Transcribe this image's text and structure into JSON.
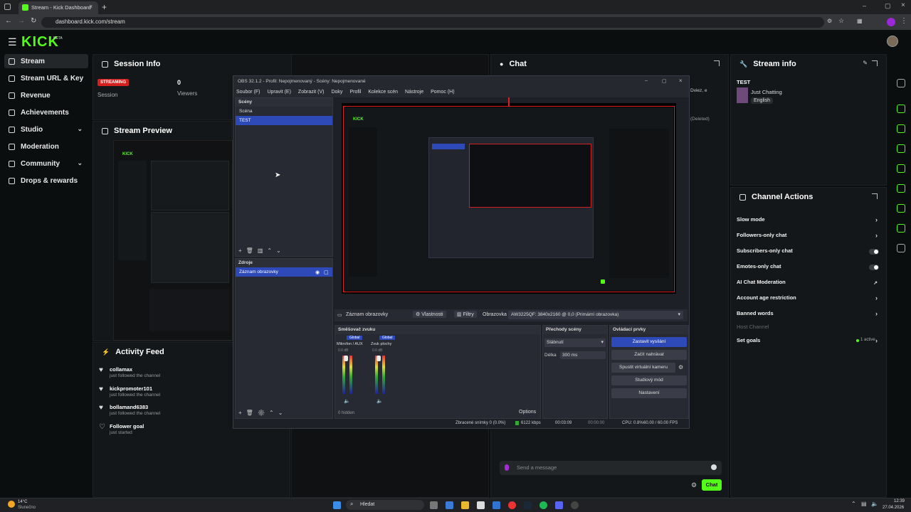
{
  "browser": {
    "tab_title": "Stream - Kick Dashboard",
    "url": "dashboard.kick.com/stream"
  },
  "header": {
    "logo": "KICK",
    "logo_badge": "BETA"
  },
  "sidenav": {
    "items": [
      {
        "label": "Stream",
        "icon": "stream-icon",
        "active": true
      },
      {
        "label": "Stream URL & Key",
        "icon": "key-icon"
      },
      {
        "label": "Revenue",
        "icon": "revenue-icon"
      },
      {
        "label": "Achievements",
        "icon": "trophy-icon"
      },
      {
        "label": "Studio",
        "icon": "studio-icon",
        "expandable": true
      },
      {
        "label": "Moderation",
        "icon": "sword-icon"
      },
      {
        "label": "Community",
        "icon": "community-icon",
        "expandable": true
      },
      {
        "label": "Drops & rewards",
        "icon": "gift-icon"
      }
    ]
  },
  "session": {
    "title": "Session Info",
    "badge": "STREAMING",
    "badge_color": "#d62020",
    "session_label": "Session",
    "viewers_value": "0",
    "viewers_label": "Viewers"
  },
  "stream_preview": {
    "title": "Stream Preview"
  },
  "activity": {
    "title": "Activity Feed",
    "items": [
      {
        "name": "collamax",
        "desc": "just followed the channel"
      },
      {
        "name": "kickpromoter101",
        "desc": "just followed the channel"
      },
      {
        "name": "bollamand6383",
        "desc": "just followed the channel"
      },
      {
        "name": "Follower goal",
        "desc": "just started"
      }
    ]
  },
  "chat": {
    "title": "Chat",
    "side_text_1": "Dviez, e",
    "side_text_2": "(Deleted)",
    "placeholder": "Send a message",
    "send_label": "Chat"
  },
  "stream_info": {
    "title": "Stream info",
    "stream_title": "TEST",
    "category": "Just Chatting",
    "language": "English"
  },
  "channel_actions": {
    "title": "Channel Actions",
    "rows": [
      {
        "label": "Slow mode",
        "control": "arrow"
      },
      {
        "label": "Followers-only chat",
        "control": "arrow"
      },
      {
        "label": "Subscribers-only chat",
        "control": "toggle"
      },
      {
        "label": "Emotes-only chat",
        "control": "toggle"
      },
      {
        "label": "AI Chat Moderation",
        "control": "link"
      },
      {
        "label": "Account age restriction",
        "control": "arrow"
      },
      {
        "label": "Banned words",
        "control": "arrow"
      },
      {
        "label": "Host Channel",
        "control": "none",
        "disabled": true
      },
      {
        "label": "Set goals",
        "control": "arrow",
        "status": "1 active"
      }
    ]
  },
  "obs": {
    "title": "OBS 32.1.2 - Profil: Nepojmenovaný - Scény: Nepojmenované",
    "menu": [
      "Soubor (F)",
      "Upravit (E)",
      "Zobrazit (V)",
      "Doky",
      "Profil",
      "Kolekce scén",
      "Nástroje",
      "Pomoc (H)"
    ],
    "scenes_title": "Scény",
    "scenes": [
      "Scéna",
      "TEST"
    ],
    "sources_title": "Zdroje",
    "sources": [
      "Záznam obrazovky"
    ],
    "source_toolbar": {
      "source": "Záznam obrazovky",
      "properties": "Vlastnosti",
      "filters": "Filtry",
      "display_label": "Obrazovka",
      "display_value": "AW3225QF: 3840x2160 @ 0,0 (Primární obrazovka)"
    },
    "mixer_title": "Směšovač zvuku",
    "mixer_channels": [
      {
        "name": "Mikrofon / AUX",
        "tag": "Global",
        "db": "0.0 dB"
      },
      {
        "name": "Zvuk plochy",
        "tag": "Global",
        "db": "0.0 dB"
      }
    ],
    "transitions_title": "Přechody scény",
    "transition_value": "Slábnutí",
    "duration_label": "Délka",
    "duration_value": "300 ms",
    "controls_title": "Ovládací prvky",
    "controls": [
      {
        "label": "Zastavit vysílání",
        "primary": true
      },
      {
        "label": "Začít nahrávat"
      },
      {
        "label": "Spustit virtuální kameru"
      },
      {
        "label": "Studiový mód"
      },
      {
        "label": "Nastavení"
      }
    ],
    "hidden_label": "0 hidden",
    "options_label": "Options",
    "status": {
      "dropped": "Zbracené snímky 0 (0.0%)",
      "bitrate": "6122 kbps",
      "live_time": "00:03:09",
      "rec_time": "00:00:00",
      "cpu": "CPU: 0.8%",
      "fps": "60.00 / 60.00 FPS"
    }
  },
  "taskbar": {
    "weather_temp": "14°C",
    "weather_desc": "Slunečno",
    "search_label": "Hledat",
    "time": "12:39",
    "date": "27.04.2026"
  }
}
